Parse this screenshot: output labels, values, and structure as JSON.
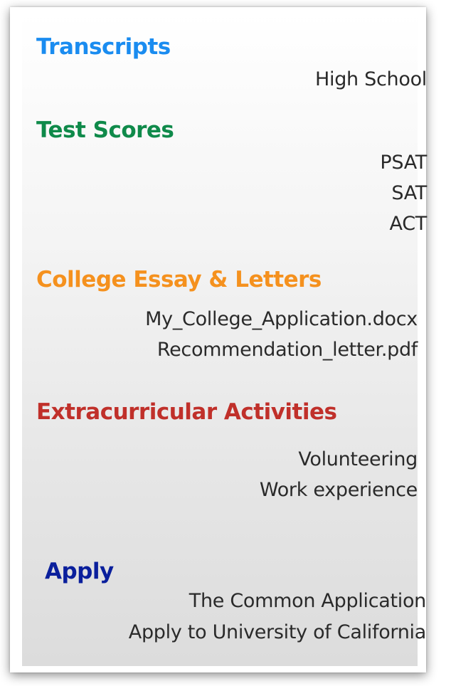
{
  "sections": {
    "transcripts": {
      "title": "Transcripts",
      "color": "#1a8cf0",
      "items": [
        "High School"
      ]
    },
    "test_scores": {
      "title": "Test Scores",
      "color": "#0f8a4a",
      "items": [
        "PSAT",
        "SAT",
        "ACT"
      ]
    },
    "essays_letters": {
      "title": "College Essay & Letters",
      "color": "#f5911e",
      "items": [
        "My_College_Application.docx",
        "Recommendation_letter.pdf"
      ]
    },
    "extracurricular": {
      "title": "Extracurricular Activities",
      "color": "#c0302a",
      "items": [
        "Volunteering",
        "Work experience"
      ]
    },
    "apply": {
      "title": "Apply",
      "color": "#0a1f9c",
      "items": [
        "The Common Application",
        "Apply to University of California"
      ]
    }
  }
}
